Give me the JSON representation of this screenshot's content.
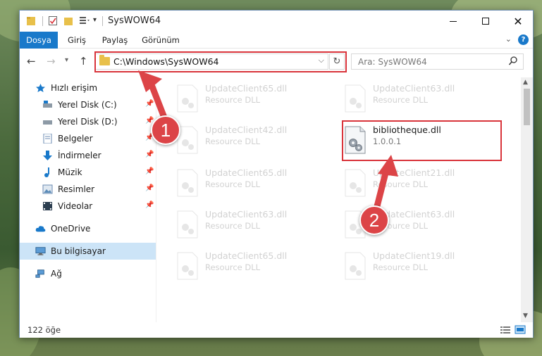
{
  "window": {
    "title": "SysWOW64"
  },
  "ribbon": {
    "tabs": [
      {
        "label": "Dosya"
      },
      {
        "label": "Giriş"
      },
      {
        "label": "Paylaş"
      },
      {
        "label": "Görünüm"
      }
    ]
  },
  "address": {
    "path": "C:\\Windows\\SysWOW64"
  },
  "search": {
    "placeholder": "Ara: SysWOW64"
  },
  "sidebar": {
    "items": [
      {
        "label": "Hızlı erişim",
        "icon": "star-icon"
      },
      {
        "label": "Yerel Disk (C:)",
        "icon": "drive-icon"
      },
      {
        "label": "Yerel Disk (D:)",
        "icon": "drive-icon"
      },
      {
        "label": "Belgeler",
        "icon": "documents-icon"
      },
      {
        "label": "İndirmeler",
        "icon": "download-icon"
      },
      {
        "label": "Müzik",
        "icon": "music-icon"
      },
      {
        "label": "Resimler",
        "icon": "pictures-icon"
      },
      {
        "label": "Videolar",
        "icon": "video-icon"
      },
      {
        "label": "OneDrive",
        "icon": "cloud-icon"
      },
      {
        "label": "Bu bilgisayar",
        "icon": "computer-icon"
      },
      {
        "label": "Ağ",
        "icon": "network-icon"
      }
    ]
  },
  "files": {
    "items": [
      {
        "name": "UpdateClient65.dll",
        "desc": "Resource DLL"
      },
      {
        "name": "UpdateClient63.dll",
        "desc": "Resource DLL"
      },
      {
        "name": "UpdateClient42.dll",
        "desc": "Resource DLL"
      },
      {
        "name": "bibliotheque.dll",
        "desc": "1.0.0.1"
      },
      {
        "name": "UpdateClient65.dll",
        "desc": "Resource DLL"
      },
      {
        "name": "UpdateClient21.dll",
        "desc": "Resource DLL"
      },
      {
        "name": "UpdateClient63.dll",
        "desc": "Resource DLL"
      },
      {
        "name": "UpdateClient63.dll",
        "desc": "Resource DLL"
      },
      {
        "name": "UpdateClient65.dll",
        "desc": "Resource DLL"
      },
      {
        "name": "UpdateClient19.dll",
        "desc": "Resource DLL"
      }
    ]
  },
  "status": {
    "count": "122 öğe"
  },
  "annotations": {
    "step1": "1",
    "step2": "2"
  },
  "colors": {
    "accent": "#1979ca",
    "highlight_box": "#d9343b",
    "badge": "#dc4447",
    "folder": "#e8c04a"
  }
}
